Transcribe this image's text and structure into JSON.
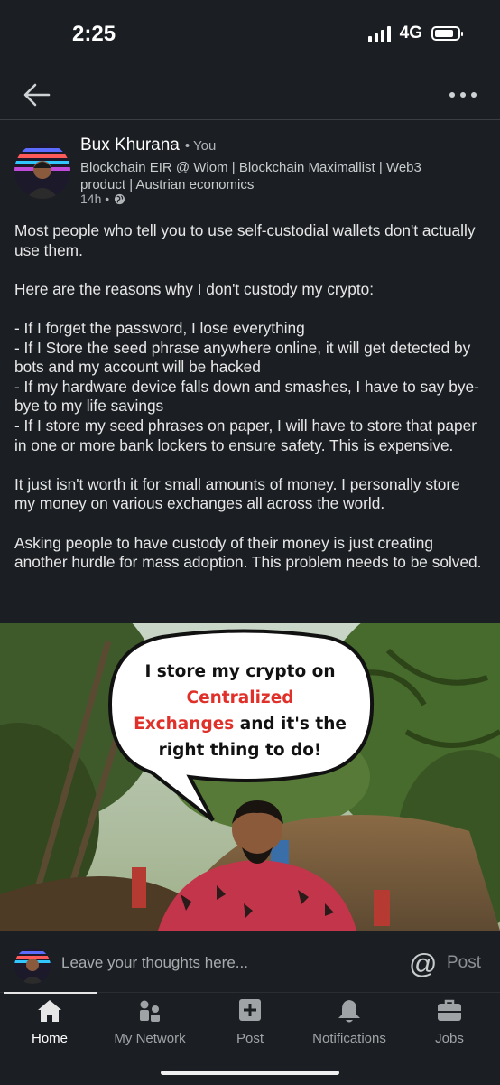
{
  "status": {
    "time": "2:25",
    "network": "4G"
  },
  "topbar": {
    "back_icon": "arrow-left-icon",
    "more_icon": "more-horizontal-icon"
  },
  "post": {
    "author": "Bux Khurana",
    "relation": "• You",
    "headline": "Blockchain EIR @ Wiom | Blockchain Maximallist | Web3 product | Austrian economics",
    "time": "14h •",
    "visibility_icon": "globe-icon",
    "paragraphs": [
      "Most people who tell you to use self-custodial wallets don't actually use them.",
      "Here are the reasons why I don't custody my crypto:",
      "- If I forget the password, I lose everything",
      "- If I Store the seed phrase anywhere online, it will get detected by bots and my account will be hacked",
      "- If my hardware device falls down and smashes, I have to say bye-bye to my life savings",
      "- If I store my seed phrases on paper, I will have to store that paper in one or more bank lockers to ensure safety. This is expensive.",
      "It just isn't worth it for small amounts of money. I personally store my money on various exchanges all across the world.",
      "Asking people to have custody of their money is just creating another hurdle for mass adoption. This problem needs to be solved."
    ],
    "image": {
      "line1": "I store my crypto on",
      "red1": "Centralized",
      "red2": "Exchanges",
      "rest2": " and it's the",
      "line4": "right thing to do!"
    }
  },
  "comment": {
    "placeholder": "Leave your thoughts here...",
    "mention_symbol": "@",
    "post_label": "Post"
  },
  "nav": {
    "items": [
      {
        "label": "Home",
        "icon": "home-icon",
        "active": true
      },
      {
        "label": "My Network",
        "icon": "network-icon"
      },
      {
        "label": "Post",
        "icon": "plus-square-icon"
      },
      {
        "label": "Notifications",
        "icon": "bell-icon"
      },
      {
        "label": "Jobs",
        "icon": "briefcase-icon"
      }
    ]
  },
  "colors": {
    "background": "#1b1f23",
    "accent_red": "#e0302a",
    "text": "#e6e6e6"
  }
}
